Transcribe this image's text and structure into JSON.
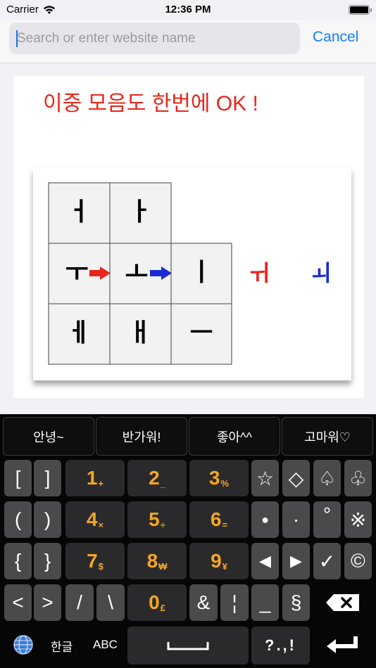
{
  "status": {
    "carrier": "Carrier",
    "time": "12:36 PM"
  },
  "search": {
    "placeholder": "Search or enter website name",
    "cancel": "Cancel"
  },
  "content": {
    "headline": "이중 모음도 한번에 OK !",
    "grid": {
      "row1": [
        "ㅓ",
        "ㅏ"
      ],
      "row2": [
        "ㅜ",
        "ㅗ",
        "ㅣ"
      ],
      "row3": [
        "ㅔ",
        "ㅐ",
        "ㅡ"
      ],
      "result_red": "ㅟ",
      "result_blue": "ㅚ",
      "colors": {
        "red": "#e8261b",
        "blue": "#1a2bd6"
      }
    }
  },
  "keyboard": {
    "phrases": [
      "안녕~",
      "반가워!",
      "좋아^^",
      "고마워♡"
    ],
    "rows": [
      {
        "left": [
          "[",
          "]"
        ],
        "nums": [
          {
            "n": "1",
            "s": "+"
          },
          {
            "n": "2",
            "s": "_"
          },
          {
            "n": "3",
            "s": "%"
          }
        ],
        "right": [
          "☆",
          "◇",
          "♤",
          "♧"
        ]
      },
      {
        "left": [
          "(",
          ")"
        ],
        "nums": [
          {
            "n": "4",
            "s": "×"
          },
          {
            "n": "5",
            "s": "÷"
          },
          {
            "n": "6",
            "s": "="
          }
        ],
        "right": [
          "●",
          "·",
          "°",
          "※"
        ]
      },
      {
        "left": [
          "{",
          "}"
        ],
        "nums": [
          {
            "n": "7",
            "s": "$"
          },
          {
            "n": "8",
            "s": "₩"
          },
          {
            "n": "9",
            "s": "¥"
          }
        ],
        "right": [
          "◀",
          "▶",
          "✓",
          "©"
        ]
      },
      {
        "left": [
          "<",
          ">"
        ],
        "nums": [
          {
            "n": "/",
            "s": ""
          },
          {
            "n": "\\",
            "s": ""
          },
          {
            "n": "0",
            "s": "£"
          }
        ],
        "right": [
          "&",
          "¦",
          "_",
          "§"
        ]
      }
    ],
    "bottom": {
      "lang_korean": "한글",
      "lang_abc": "ABC",
      "punct": "?.,!"
    },
    "icons": {
      "globe": "globe-icon",
      "backspace": "backspace-icon",
      "return": "return-icon",
      "space": "space-icon"
    }
  }
}
